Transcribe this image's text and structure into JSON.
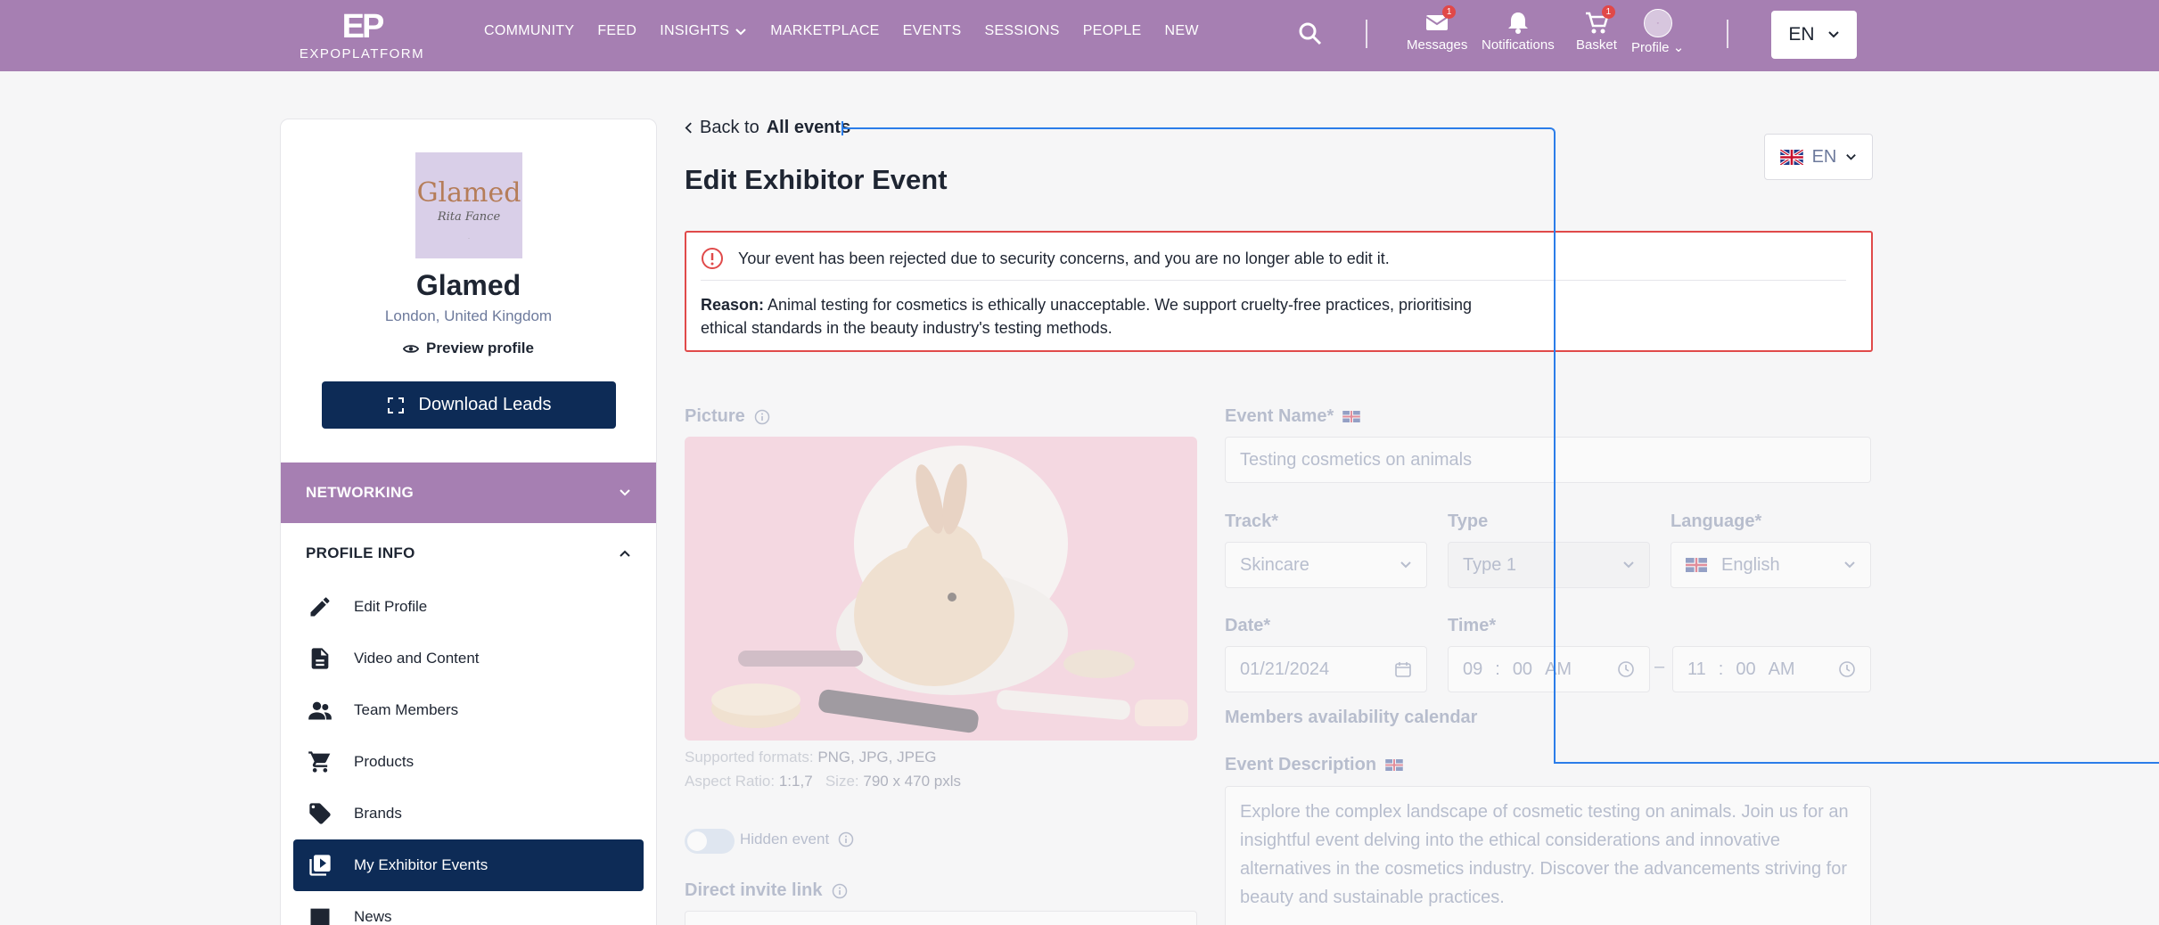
{
  "header": {
    "logo_mark": "EP",
    "logo_text": "EXPOPLATFORM",
    "nav": [
      {
        "label": "COMMUNITY"
      },
      {
        "label": "FEED"
      },
      {
        "label": "INSIGHTS"
      },
      {
        "label": "MARKETPLACE"
      },
      {
        "label": "EVENTS"
      },
      {
        "label": "SESSIONS"
      },
      {
        "label": "PEOPLE"
      },
      {
        "label": "NEW"
      }
    ],
    "messages_label": "Messages",
    "messages_badge": "1",
    "notifications_label": "Notifications",
    "basket_label": "Basket",
    "basket_badge": "1",
    "profile_label": "Profile",
    "language": "EN"
  },
  "sidebar": {
    "company_logo_text": "Glamed",
    "company_logo_sub": "Rita Fance",
    "company_name": "Glamed",
    "location": "London, United Kingdom",
    "preview_label": "Preview profile",
    "download_label": "Download Leads",
    "networking_label": "NETWORKING",
    "profile_info_label": "PROFILE INFO",
    "menu": [
      {
        "label": "Edit Profile",
        "icon": "pencil-icon"
      },
      {
        "label": "Video and Content",
        "icon": "document-icon"
      },
      {
        "label": "Team Members",
        "icon": "people-icon"
      },
      {
        "label": "Products",
        "icon": "cart-icon"
      },
      {
        "label": "Brands",
        "icon": "tag-icon"
      },
      {
        "label": "My Exhibitor Events",
        "icon": "video-library-icon",
        "active": true
      },
      {
        "label": "News",
        "icon": "news-icon"
      }
    ]
  },
  "main": {
    "back_prefix": "Back to",
    "back_link": "All events",
    "title": "Edit Exhibitor Event",
    "language": "EN",
    "alert": {
      "message": "Your event has been rejected due to security concerns, and you are no longer able to edit it.",
      "reason_label": "Reason:",
      "reason_text": "Animal testing for cosmetics is ethically unacceptable. We support cruelty-free practices, prioritising ethical standards in the beauty industry's testing methods."
    },
    "form": {
      "picture_label": "Picture",
      "formats_label": "Supported formats:",
      "formats_value": "PNG, JPG, JPEG",
      "ratio_label": "Aspect Ratio:",
      "ratio_value": "1:1,7",
      "size_label": "Size:",
      "size_value": "790 x 470 pxls",
      "hidden_label": "Hidden event",
      "hidden_on": false,
      "invite_label": "Direct invite link",
      "name_label": "Event Name*",
      "name_value": "Testing cosmetics on animals",
      "track_label": "Track*",
      "track_value": "Skincare",
      "type_label": "Type",
      "type_value": "Type 1",
      "language_label": "Language*",
      "language_value": "English",
      "date_label": "Date*",
      "date_value": "01/21/2024",
      "time_label": "Time*",
      "time_start": {
        "h": "09",
        "m": "00",
        "ampm": "AM"
      },
      "time_sep": "–",
      "time_end": {
        "h": "11",
        "m": "00",
        "ampm": "AM"
      },
      "availability_label": "Members availability calendar",
      "description_label": "Event Description",
      "description_value": "Explore the complex landscape of cosmetic testing on animals. Join us for an insightful event delving into the ethical considerations and innovative alternatives in the cosmetics industry. Discover the advancements striving for beauty and sustainable practices."
    }
  },
  "colors": {
    "brand_purple": "#a67fb2",
    "navy": "#0d2b56",
    "alert_red": "#e04a4a",
    "overlay_blue": "#2b7de9"
  }
}
